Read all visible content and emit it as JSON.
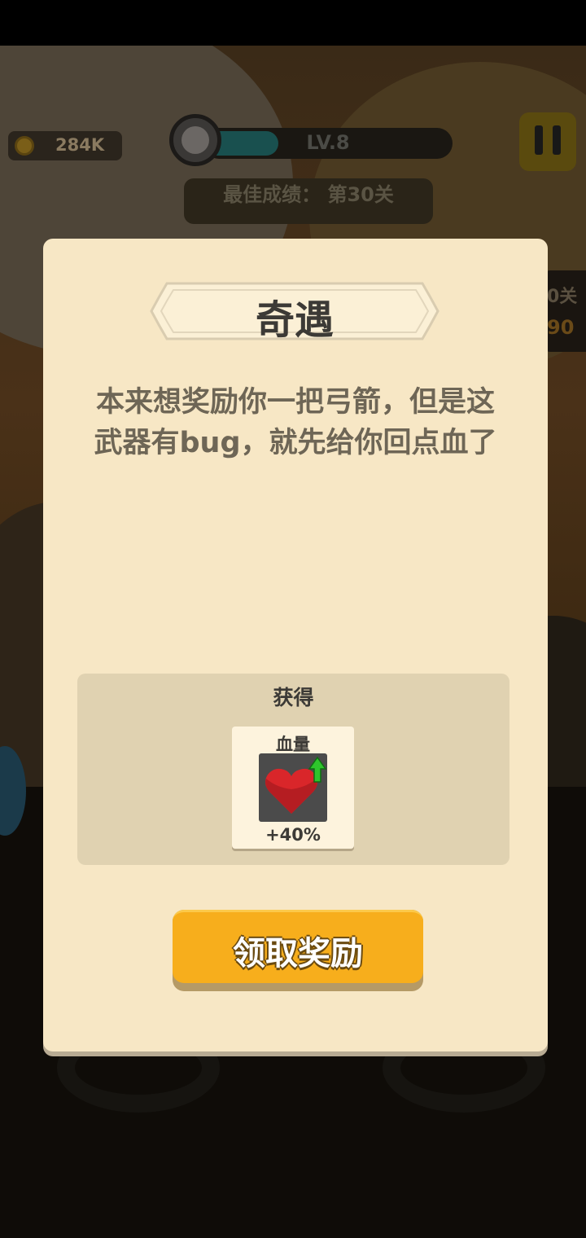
{
  "hud": {
    "coins": "284K",
    "level": "LV.8",
    "level_progress": 0.3,
    "best_score": "最佳成绩： 第30关",
    "side_tab_text": "0关",
    "side_tab_value": "90"
  },
  "dialog": {
    "title": "奇遇",
    "message_line1": "本来想奖励你一把弓箭，但是这",
    "message_line2": "武器有bug，就先给你回点血了",
    "reward_title": "获得",
    "reward_name": "血量",
    "reward_value": "+40%",
    "reward_icon": "heart-up-icon",
    "claim_label": "领取奖励"
  },
  "colors": {
    "dialog_bg": "#f7e7c5",
    "button": "#f7ae1c",
    "heart": "#d9262a",
    "arrow": "#2ec52c"
  }
}
